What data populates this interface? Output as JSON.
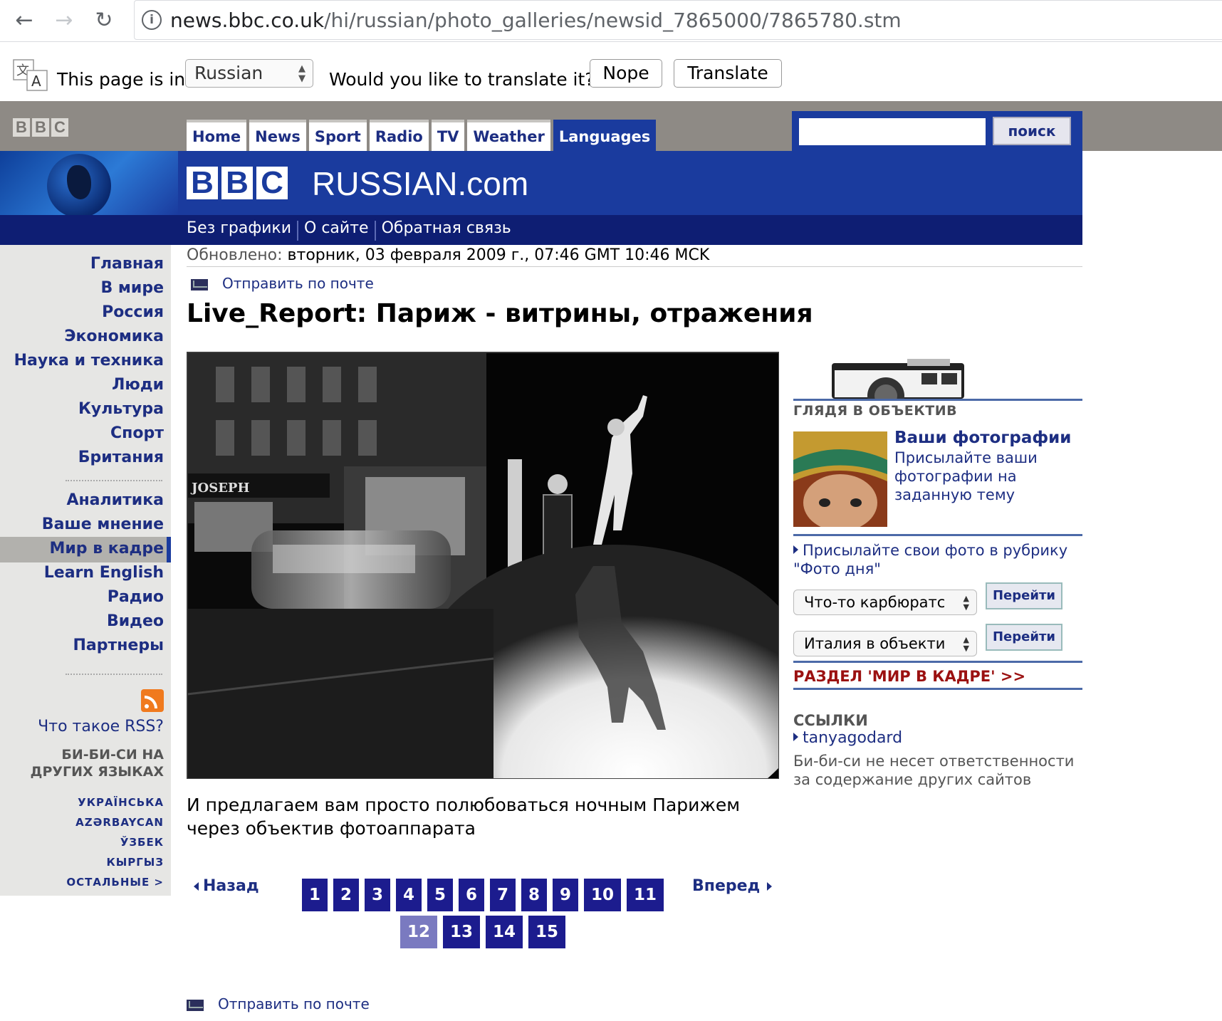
{
  "browser": {
    "url_host": "news.bbc.co.uk",
    "url_path": "/hi/russian/photo_galleries/newsid_7865000/7865780.stm"
  },
  "translate_bar": {
    "label": "This page is in",
    "language": "Russian",
    "question": "Would you like to translate it?",
    "nope": "Nope",
    "translate": "Translate"
  },
  "header": {
    "tabs": [
      "Home",
      "News",
      "Sport",
      "Radio",
      "TV",
      "Weather",
      "Languages"
    ],
    "search_button": "поиск",
    "site_name": "RUSSIAN.com",
    "bbc_letters": [
      "B",
      "B",
      "C"
    ],
    "sublinks": [
      "Без графики",
      "О сайте",
      "Обратная связь"
    ]
  },
  "leftnav": {
    "group1": [
      "Главная",
      "В мире",
      "Россия",
      "Экономика",
      "Наука и техника",
      "Люди",
      "Культура",
      "Спорт",
      "Британия"
    ],
    "group2": [
      "Аналитика",
      "Ваше мнение",
      "Мир в кадре",
      "Learn English",
      "Радио",
      "Видео",
      "Партнеры"
    ],
    "rss": "Что такое RSS?",
    "other_langs_title_1": "БИ-БИ-СИ НА",
    "other_langs_title_2": "ДРУГИХ ЯЗЫКАХ",
    "languages": [
      "УКРАЇНСЬКА",
      "AZƏRBAYCAN",
      "ЎЗБЕК",
      "КЫРГЫЗ",
      "ОСТАЛЬНЫЕ >"
    ]
  },
  "article": {
    "updated_label": "Обновлено:",
    "updated_value": "вторник, 03 февраля 2009 г., 07:46 GMT 10:46 MCK",
    "send_mail": "Отправить по почте",
    "title": "Live_Report: Париж - витрины, отражения",
    "photo_sign": "JOSEPH",
    "caption": "И предлагаем вам просто полюбоваться ночным Парижем через объектив фотоаппарата",
    "prev": "Назад",
    "next": "Вперед",
    "pages": [
      "1",
      "2",
      "3",
      "4",
      "5",
      "6",
      "7",
      "8",
      "9",
      "10",
      "11",
      "12",
      "13",
      "14",
      "15"
    ],
    "current_page": "12"
  },
  "right": {
    "heading": "ГЛЯДЯ В ОБЪЕКТИВ",
    "photos_title": "Ваши фотографии",
    "photos_desc": "Присылайте ваши фотографии на заданную тему",
    "send_photo": "Присылайте свои фото в рубрику \"Фото дня\"",
    "select1": "Что-то карбюратс",
    "select2": "Италия в объекти",
    "go": "Перейти",
    "section_link": "РАЗДЕЛ 'МИР В КАДРЕ' >>",
    "links_heading": "ССЫЛКИ",
    "link1": "tanyagodard",
    "disclaimer": "Би-би-си не несет ответственности за содержание других сайтов"
  },
  "colors": {
    "bbc_blue": "#1a3b9e",
    "bbc_dark_blue": "#0e1e73",
    "link_blue": "#1d2e82",
    "grey_bar": "#8e8a85",
    "section_red": "#9b1111"
  }
}
